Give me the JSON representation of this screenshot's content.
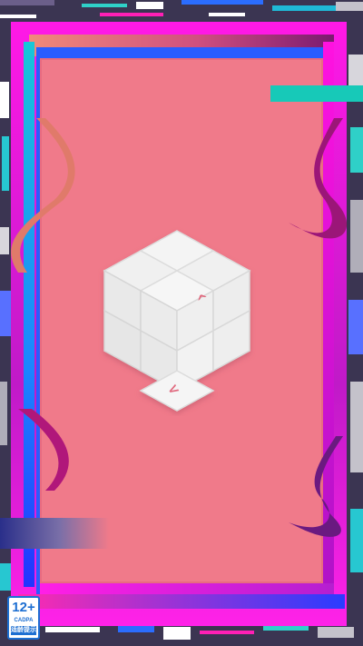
{
  "game": {
    "panel_color": "#f07a8a",
    "frame_primary_color": "#ff19e6",
    "frame_secondary_color": "#2a5cff",
    "accent_teal": "#17c9b8",
    "cube_color": "#f2f2f2",
    "arrow_color": "#e0697e"
  },
  "puzzle": {
    "shape": "isometric-cube",
    "arrows": [
      {
        "name": "arrow-hint-top",
        "glyph": "^"
      },
      {
        "name": "arrow-hint-bottom",
        "glyph": "<"
      }
    ]
  },
  "rating_badge": {
    "age": "12+",
    "org": "CADPA",
    "note": "适龄提示"
  }
}
